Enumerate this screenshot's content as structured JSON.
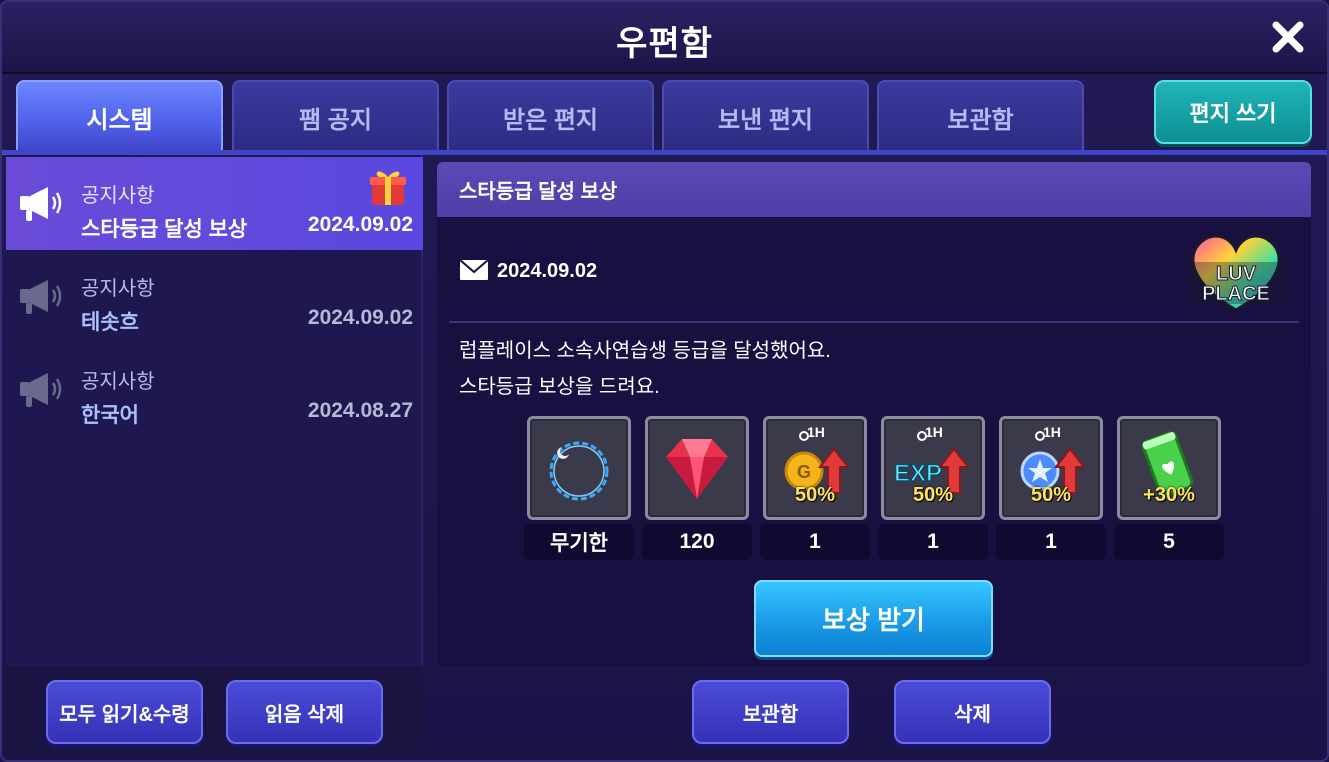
{
  "window": {
    "title": "우편함"
  },
  "tabs": [
    {
      "label": "시스템",
      "active": true
    },
    {
      "label": "팸 공지",
      "active": false
    },
    {
      "label": "받은 편지",
      "active": false
    },
    {
      "label": "보낸 편지",
      "active": false
    },
    {
      "label": "보관함",
      "active": false
    }
  ],
  "write_button": "편지 쓰기",
  "messages": [
    {
      "category": "공지사항",
      "subject": "스타등급 달성 보상",
      "date": "2024.09.02",
      "active": true,
      "icon": "megaphone-icon",
      "badge": "gift-icon"
    },
    {
      "category": "공지사항",
      "subject": "테솟흐",
      "date": "2024.09.02",
      "active": false,
      "icon": "megaphone-icon"
    },
    {
      "category": "공지사항",
      "subject": "한국어",
      "date": "2024.08.27",
      "active": false,
      "icon": "megaphone-icon"
    }
  ],
  "left_footer": {
    "read_all": "모두 읽기&수령",
    "delete_read": "읽음 삭제"
  },
  "detail": {
    "title": "스타등급 달성 보상",
    "date": "2024.09.02",
    "logo_text": "LUV PLACE",
    "body": [
      "럽플레이스 소속사연습생 등급을 달성했어요.",
      "스타등급 보상을 드려요."
    ],
    "rewards": [
      {
        "icon": "ring-frame-icon",
        "count": "무기한"
      },
      {
        "icon": "red-gem-icon",
        "count": "120"
      },
      {
        "icon": "gold-boost-icon",
        "timer": "1H",
        "label": "50%",
        "count": "1"
      },
      {
        "icon": "exp-boost-icon",
        "timer": "1H",
        "label": "50%",
        "count": "1"
      },
      {
        "icon": "star-boost-icon",
        "timer": "1H",
        "label": "50%",
        "count": "1"
      },
      {
        "icon": "energy-drink-icon",
        "label": "+30%",
        "count": "5"
      }
    ],
    "claim_button": "보상 받기"
  },
  "bottom_buttons": {
    "archive": "보관함",
    "delete": "삭제"
  },
  "colors": {
    "accent": "#4f5fe8",
    "teal": "#0f8d94",
    "claim": "#1a9be8"
  }
}
